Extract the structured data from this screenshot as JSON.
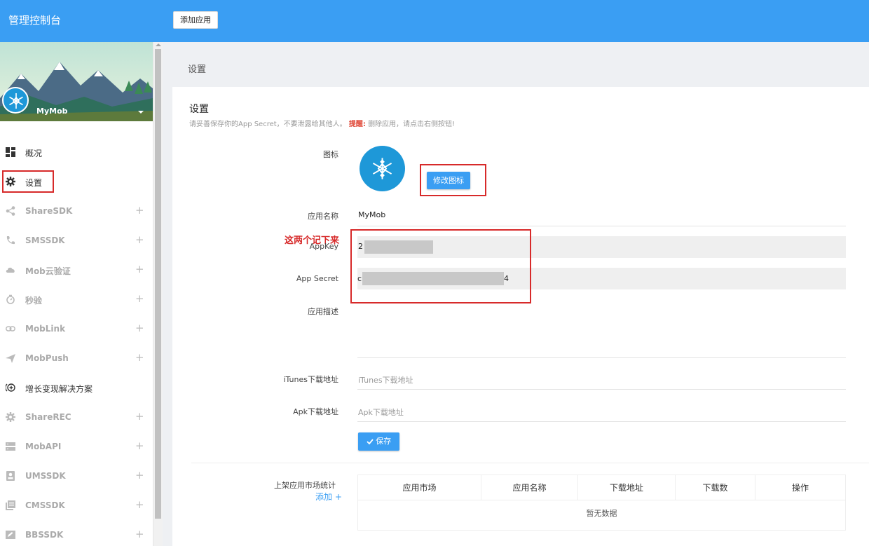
{
  "header": {
    "title": "管理控制台",
    "add_app_label": "添加应用"
  },
  "sidebar": {
    "app_name": "MyMob",
    "items": [
      {
        "label": "概况",
        "icon": "dashboard-icon",
        "expandable": false
      },
      {
        "label": "设置",
        "icon": "gear-icon",
        "expandable": false
      },
      {
        "label": "ShareSDK",
        "icon": "share-icon",
        "expandable": true
      },
      {
        "label": "SMSSDK",
        "icon": "phone-icon",
        "expandable": true
      },
      {
        "label": "Mob云验证",
        "icon": "cloud-icon",
        "expandable": true
      },
      {
        "label": "秒验",
        "icon": "timer-icon",
        "expandable": true
      },
      {
        "label": "MobLink",
        "icon": "link-icon",
        "expandable": true
      },
      {
        "label": "MobPush",
        "icon": "send-icon",
        "expandable": true
      },
      {
        "label": "增长变现解决方案",
        "icon": "plus-circle-icon",
        "expandable": false
      },
      {
        "label": "ShareREC",
        "icon": "gear-icon",
        "expandable": true
      },
      {
        "label": "MobAPI",
        "icon": "server-icon",
        "expandable": true
      },
      {
        "label": "UMSSDK",
        "icon": "user-card-icon",
        "expandable": true
      },
      {
        "label": "CMSSDK",
        "icon": "document-icon",
        "expandable": true
      },
      {
        "label": "BBSSDK",
        "icon": "edit-icon",
        "expandable": true
      }
    ],
    "plus_symbol": "+"
  },
  "breadcrumb": "设置",
  "settings": {
    "title": "设置",
    "subtitle_prefix": "请妥善保存你的App Secret，不要泄露给其他人。",
    "warning_label": "提醒:",
    "warning_text": "删除应用，请点击右侧按钮!",
    "icon_label": "图标",
    "change_icon_label": "修改图标",
    "app_name_label": "应用名称",
    "app_name_value": "MyMob",
    "annotation": "这两个记下来",
    "appkey_label": "AppKey",
    "appkey_first_char": "2",
    "secret_label": "App Secret",
    "secret_first_char": "c",
    "secret_last_char": "4",
    "desc_label": "应用描述",
    "itunes_label": "iTunes下载地址",
    "itunes_placeholder": "iTunes下载地址",
    "apk_label": "Apk下载地址",
    "apk_placeholder": "Apk下载地址",
    "save_label": "保存",
    "market_label": "上架应用市场统计",
    "add_label": "添加 +",
    "table_headers": [
      "应用市场",
      "应用名称",
      "下载地址",
      "下载数",
      "操作"
    ],
    "empty_text": "暂无数据"
  },
  "colors": {
    "primary": "#3a9ef3",
    "annotation_red": "#d72a2a",
    "warning": "#e04b3b",
    "icon_bg": "#1e98d8"
  }
}
